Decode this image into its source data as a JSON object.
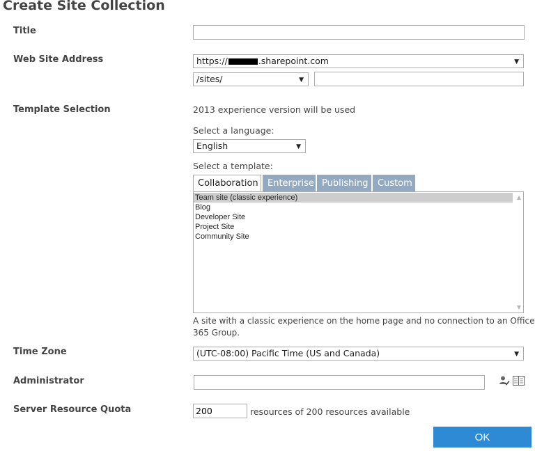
{
  "page_title": "Create Site Collection",
  "title_field": {
    "label": "Title",
    "value": ""
  },
  "web_address": {
    "label": "Web Site Address",
    "domain_prefix": "https://",
    "domain_suffix": ".sharepoint.com",
    "path_prefix": "/sites/",
    "url_value": ""
  },
  "template": {
    "label": "Template Selection",
    "experience_note": "2013 experience version will be used",
    "language_label": "Select a language:",
    "language_value": "English",
    "template_label": "Select a template:",
    "tabs": [
      "Collaboration",
      "Enterprise",
      "Publishing",
      "Custom"
    ],
    "items": [
      "Team site (classic experience)",
      "Blog",
      "Developer Site",
      "Project Site",
      "Community Site"
    ],
    "description_line1": "A site with a classic experience on the home page and no connection to an Office",
    "description_line2": "365 Group."
  },
  "time_zone": {
    "label": "Time Zone",
    "value": "(UTC-08:00) Pacific Time (US and Canada)"
  },
  "administrator": {
    "label": "Administrator",
    "value": ""
  },
  "quota": {
    "label": "Server Resource Quota",
    "value": "200",
    "suffix": "resources of 200 resources available"
  },
  "ok_label": "OK",
  "icons": {
    "check_names": "person-check-icon",
    "browse": "address-book-icon",
    "dropdown": "chevron-down-icon"
  }
}
